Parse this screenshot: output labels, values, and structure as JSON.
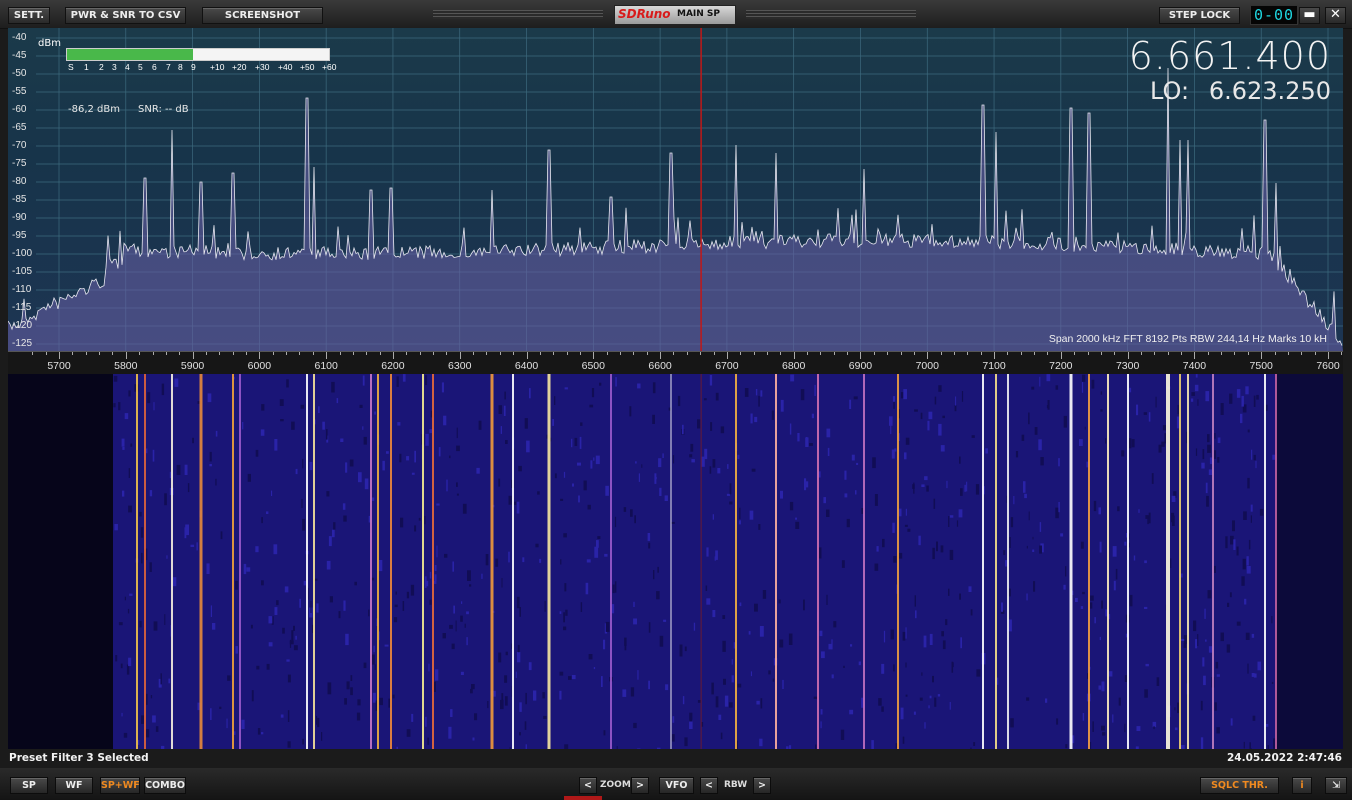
{
  "toolbar": {
    "sett": "SETT.",
    "csv": "PWR & SNR TO CSV",
    "screenshot": "SCREENSHOT",
    "logo": "SDRuno",
    "panel_title": "MAIN SP",
    "step_lock": "STEP LOCK",
    "clock": "0-00",
    "minimize": "▬",
    "close": "✕"
  },
  "spectrum": {
    "unit": "dBm",
    "y_ticks": [
      "-40",
      "-45",
      "-50",
      "-55",
      "-60",
      "-65",
      "-70",
      "-75",
      "-80",
      "-85",
      "-90",
      "-95",
      "-100",
      "-105",
      "-110",
      "-115",
      "-120",
      "-125"
    ],
    "s_meter_labels": [
      "S",
      "1",
      "2",
      "3",
      "4",
      "5",
      "6",
      "7",
      "8",
      "9",
      "+10",
      "+20",
      "+30",
      "+40",
      "+50",
      "+60"
    ],
    "s_meter_fill_fraction": 0.48,
    "level": "-86,2 dBm",
    "snr": "SNR: -- dB",
    "frequency": "6.661.400",
    "lo_label": "LO:",
    "lo_value": "6.623.250",
    "info": "Span 2000 kHz   FFT 8192 Pts   RBW 244,14 Hz   Marks 10 kH",
    "x_ticks": [
      "5700",
      "5800",
      "5900",
      "6000",
      "6100",
      "6200",
      "6300",
      "6400",
      "6500",
      "6600",
      "6700",
      "6800",
      "6900",
      "7000",
      "7100",
      "7200",
      "7300",
      "7400",
      "7500",
      "7600"
    ],
    "center_marker_khz": 6661.4,
    "colors": {
      "trace": "#e8e8f0",
      "fill": "#5a4f8c",
      "marker": "#c01818",
      "smeter": "#49b84a"
    }
  },
  "status": {
    "left": "Preset Filter 3 Selected",
    "right": "24.05.2022 2:47:46"
  },
  "bottom": {
    "sp": "SP",
    "wf": "WF",
    "spwf": "SP+WF",
    "combo": "COMBO",
    "zoom_prev": "<",
    "zoom_label": "ZOOM",
    "zoom_next": ">",
    "vfo": "VFO",
    "rbw_prev": "<",
    "rbw_label": "RBW",
    "rbw_next": ">",
    "sqlc": "SQLC THR.",
    "info": "i",
    "resize": "⇲"
  }
}
